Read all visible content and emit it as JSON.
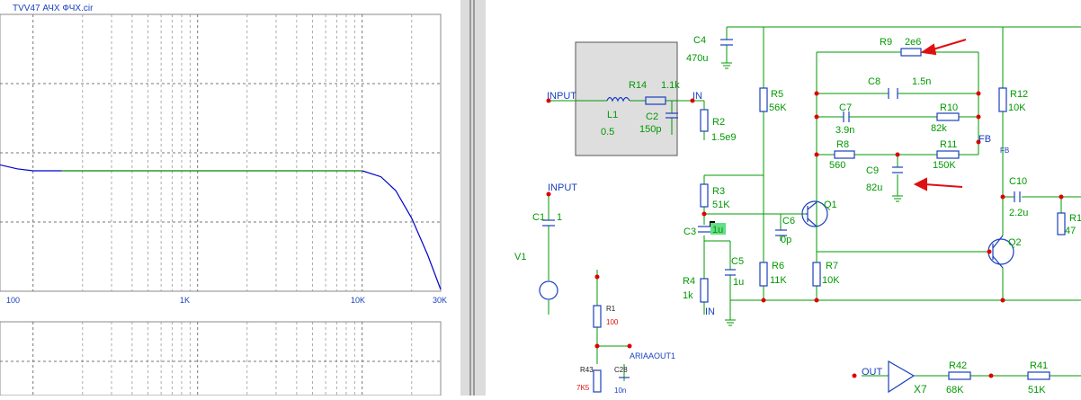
{
  "plot": {
    "title": "TVV47 АЧХ ФЧХ.cir",
    "x_ticks": [
      "100",
      "1K",
      "10K",
      "30K"
    ],
    "curve_color": "#0000cc",
    "curve_color2": "#008800",
    "chart_data": {
      "type": "line",
      "title": "TVV47 АЧХ ФЧХ.cir",
      "xscale": "log",
      "xlim": [
        63,
        30000
      ],
      "tick_labels": [
        "100",
        "1K",
        "10K",
        "30K"
      ],
      "series": [
        {
          "x": [
            63,
            80,
            100,
            150,
            250,
            400,
            700,
            1000,
            2000,
            4000,
            7000,
            10000,
            13000,
            16000,
            20000,
            25000,
            30000
          ],
          "y": [
            0.6,
            0.2,
            0.0,
            0.0,
            0.0,
            0.0,
            0.0,
            0.0,
            0.0,
            0.0,
            0.0,
            0.0,
            -0.6,
            -2.0,
            -4.8,
            -8.5,
            -12.0
          ]
        }
      ]
    }
  },
  "schematic": {
    "components": {
      "R9": {
        "name": "R9",
        "value": "2e6"
      },
      "C8": {
        "name": "C8",
        "value": "1.5n"
      },
      "C7": {
        "name": "C7",
        "value": "3.9n"
      },
      "R10": {
        "name": "R10",
        "value": "82k"
      },
      "R8": {
        "name": "R8",
        "value": "560"
      },
      "R11": {
        "name": "R11",
        "value": "150K"
      },
      "C9": {
        "name": "C9",
        "value": "82u"
      },
      "C4": {
        "name": "C4",
        "value": "470u"
      },
      "R5": {
        "name": "R5",
        "value": "56K"
      },
      "R12": {
        "name": "R12",
        "value": "10K"
      },
      "L1": {
        "name": "L1",
        "value": "0.5"
      },
      "R14": {
        "name": "R14",
        "value": "1.1k"
      },
      "C2": {
        "name": "C2",
        "value": "150p"
      },
      "R2": {
        "name": "R2",
        "value": "1.5e9"
      },
      "R3": {
        "name": "R3",
        "value": "51K"
      },
      "C3": {
        "name": "C3",
        "value": "1u"
      },
      "C6": {
        "name": "C6",
        "value": "0p"
      },
      "Q1": {
        "name": "Q1"
      },
      "Q2": {
        "name": "Q2"
      },
      "C10": {
        "name": "C10",
        "value": "2.2u"
      },
      "R1x": {
        "name": "R1",
        "value": "47"
      },
      "C1": {
        "name": "C1",
        "value": "1"
      },
      "V1": {
        "name": "V1"
      },
      "R4": {
        "name": "R4",
        "value": "1k"
      },
      "C5": {
        "name": "C5",
        "value": "1u"
      },
      "R6": {
        "name": "R6",
        "value": "11K"
      },
      "R7": {
        "name": "R7",
        "value": "10K"
      },
      "R1": {
        "name": "R1",
        "value": "100"
      },
      "R43": {
        "name": "R43",
        "value": "7K5"
      },
      "C28": {
        "name": "C28",
        "value": "10n"
      },
      "R42": {
        "name": "R42",
        "value": "68K"
      },
      "R41": {
        "name": "R41",
        "value": "51K"
      },
      "X7": {
        "name": "X7"
      }
    },
    "nodes": {
      "input_top": "INPUT",
      "in_top": "IN",
      "fb_main": "FB",
      "fb_small": "FB",
      "input_mid": "INPUT",
      "in_bottom": "IN",
      "ariaaout": "ARIAAOUT1",
      "out": "OUT"
    }
  }
}
